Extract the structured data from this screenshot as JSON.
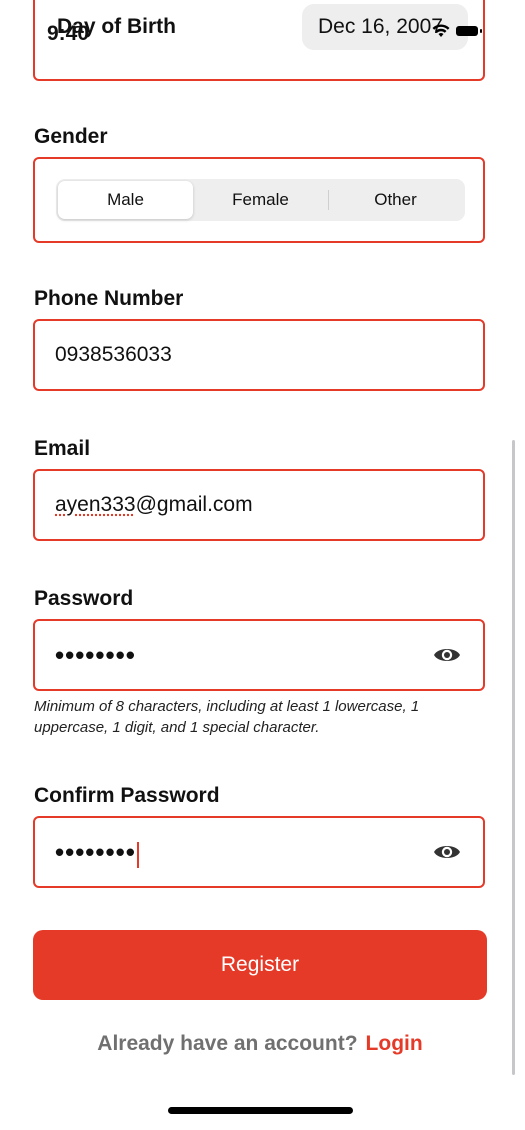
{
  "status_bar": {
    "time": "9:40"
  },
  "form": {
    "dob": {
      "label": "Day of Birth",
      "value": "Dec 16, 2007"
    },
    "gender": {
      "label": "Gender",
      "options": [
        "Male",
        "Female",
        "Other"
      ],
      "selected": "Male"
    },
    "phone": {
      "label": "Phone Number",
      "value": "0938536033"
    },
    "email": {
      "label": "Email",
      "value_flagged": "ayen333",
      "value_rest": "@gmail.com"
    },
    "password": {
      "label": "Password",
      "masked_value": "••••••••",
      "hint": "Minimum of 8 characters, including at least 1 lowercase, 1 uppercase, 1 digit, and 1 special character."
    },
    "confirm_password": {
      "label": "Confirm Password",
      "masked_value": "••••••••"
    },
    "register_label": "Register"
  },
  "footer": {
    "prompt": "Already have an account?",
    "login_label": "Login"
  },
  "colors": {
    "accent": "#e53a28",
    "muted_text": "#707070",
    "segment_bg": "#eeeeef"
  },
  "icons": {
    "status": [
      "wifi-icon",
      "battery-icon"
    ],
    "password_toggle": "eye-icon"
  }
}
